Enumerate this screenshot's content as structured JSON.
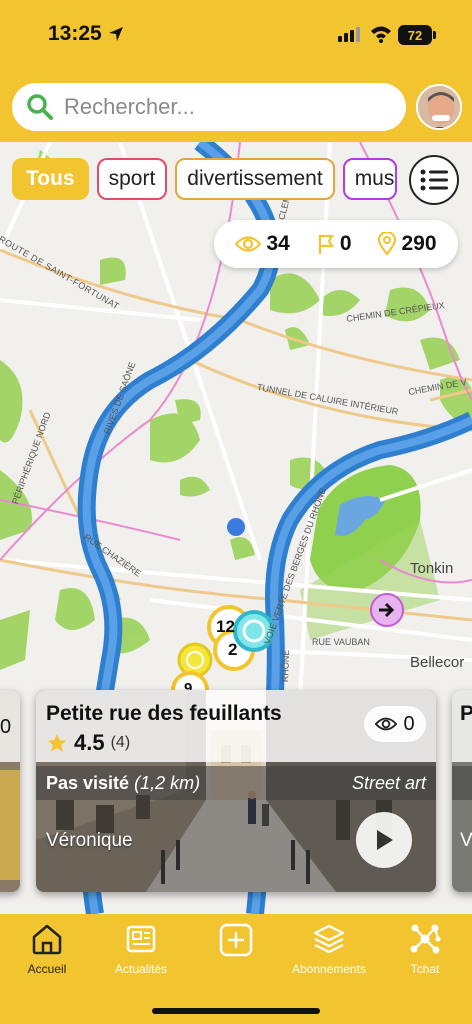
{
  "status": {
    "time": "13:25",
    "battery": "72"
  },
  "search": {
    "placeholder": "Rechercher..."
  },
  "filters": [
    "Tous",
    "sport",
    "divertissement",
    "mus"
  ],
  "stats": {
    "views": "34",
    "flags": "0",
    "places": "290"
  },
  "map_labels": {
    "route_fortunat": "ROUTE DE SAINT-FORTUNAT",
    "quai_clemenceau": "QUAI CLEMENCEAU",
    "chemin_crepieux": "CHEMIN DE CRÉPIEUX",
    "chemin_v": "CHEMIN DE V",
    "tunnel": "TUNNEL DE CALUIRE INTÉRIEUR",
    "rives_saone": "RIVES DE SAÔNE",
    "peripherique": "PÉRIPHÉRIQUE NORD",
    "rue_chaziere": "RUE CHAZIÈRE",
    "voie_verte": "VOIE VERTE DES BERGES DU RHÔNE",
    "rhone": "RHÔNE",
    "rue_vauban": "RUE VAUBAN",
    "tonkin": "Tonkin",
    "bellecour": "Bellecor",
    "cluster_a": "12",
    "cluster_b": "2",
    "cluster_c": "9"
  },
  "card": {
    "title": "Petite rue des feuillants",
    "rating": "4.5",
    "rating_count": "(4)",
    "views": "0",
    "status": "Pas visité",
    "distance": "(1,2 km)",
    "category": "Street art",
    "author": "Véronique"
  },
  "side_cards": {
    "left_views": "0",
    "right_initial": "P",
    "right_author_initial": "V"
  },
  "nav": {
    "home": "Accueil",
    "news": "Actualités",
    "add": "",
    "subscriptions": "Abonnements",
    "chat": "Tchat"
  },
  "colors": {
    "accent": "#f2c430",
    "river": "#2f7fd0",
    "park": "#8fd14f"
  }
}
